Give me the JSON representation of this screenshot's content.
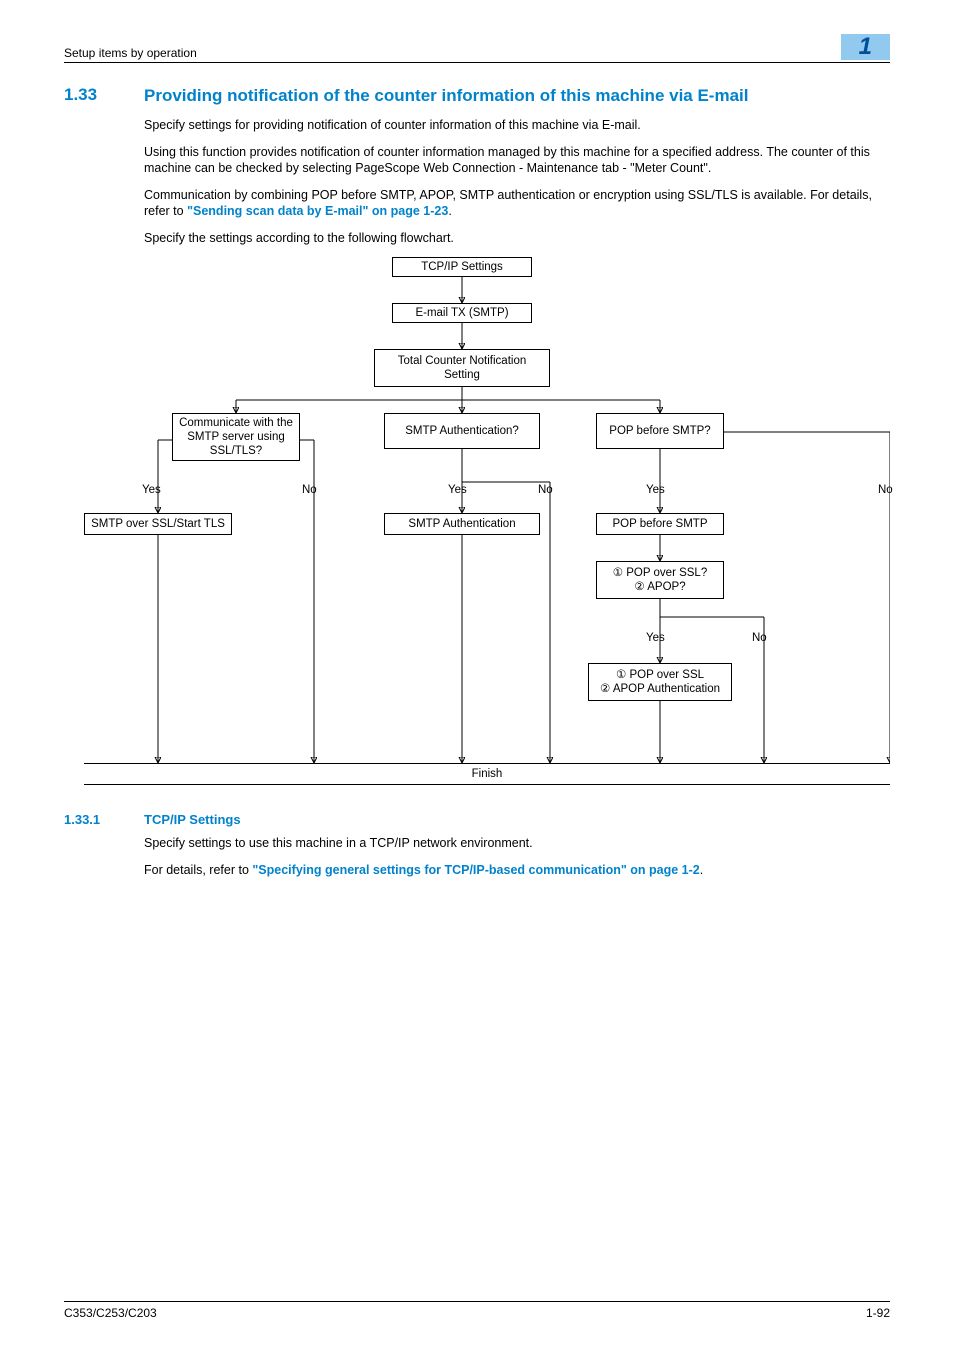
{
  "header": {
    "left": "Setup items by operation",
    "right": "1"
  },
  "section": {
    "num": "1.33",
    "title": "Providing notification of the counter information of this machine via E-mail",
    "p1": "Specify settings for providing notification of counter information of this machine via E-mail.",
    "p2": "Using this function provides notification of counter information managed by this machine for a specified address. The counter of this machine can be checked by selecting PageScope Web Connection - Maintenance tab - \"Meter Count\".",
    "p3a": "Communication by combining POP before SMTP, APOP, SMTP authentication or encryption using SSL/TLS is available. For details, refer to ",
    "p3_link": "\"Sending scan data by E-mail\" on page 1-23",
    "p3b": ".",
    "p4": "Specify the settings according to the following flowchart."
  },
  "flow": {
    "tcpip": "TCP/IP Settings",
    "emailtx": "E-mail TX (SMTP)",
    "total": "Total Counter Notification Setting",
    "ssl_q": "Communicate with the SMTP server using SSL/TLS?",
    "smtp_q": "SMTP Authentication?",
    "pop_q": "POP before SMTP?",
    "yes1": "Yes",
    "no1": "No",
    "yes2": "Yes",
    "no2": "No",
    "yes3": "Yes",
    "no3": "No",
    "ssl_a": "SMTP over SSL/Start TLS",
    "smtp_a": "SMTP Authentication",
    "pop_a": "POP before SMTP",
    "pop_q2a": "① POP over SSL?",
    "pop_q2b": "② APOP?",
    "yes4": "Yes",
    "no4": "No",
    "pop_a2a": "① POP over SSL",
    "pop_a2b": "② APOP Authentication",
    "finish": "Finish"
  },
  "subsection": {
    "num": "1.33.1",
    "title": "TCP/IP Settings",
    "p1": "Specify settings to use this machine in a TCP/IP network environment.",
    "p2a": "For details, refer to ",
    "p2_link": "\"Specifying general settings for TCP/IP-based communication\" on page 1-2",
    "p2b": "."
  },
  "footer": {
    "left": "C353/C253/C203",
    "right": "1-92"
  }
}
